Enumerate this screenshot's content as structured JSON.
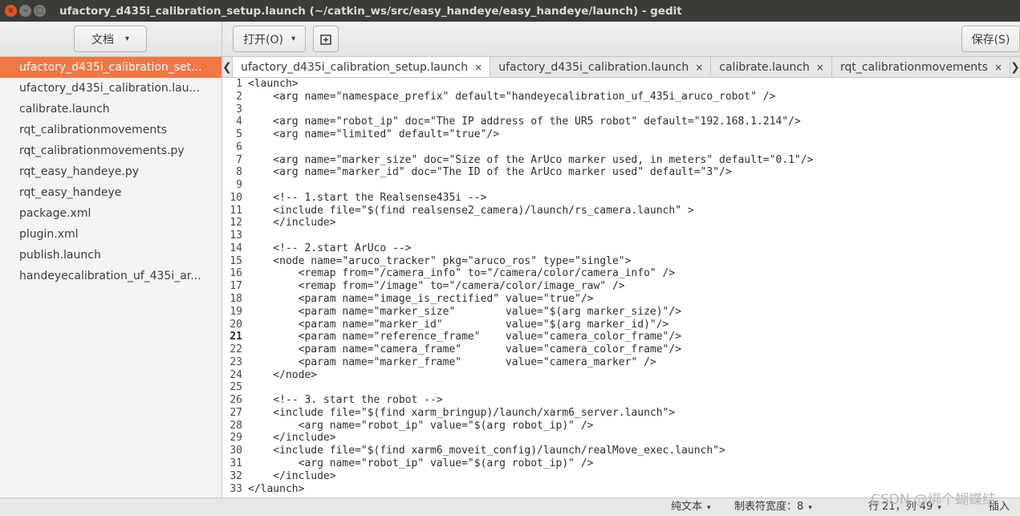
{
  "window": {
    "title": "ufactory_d435i_calibration_setup.launch (~/catkin_ws/src/easy_handeye/easy_handeye/launch) - gedit",
    "close_glyph": "×",
    "min_glyph": "–",
    "max_glyph": "□"
  },
  "toolbar": {
    "docs_label": "文档",
    "open_label": "打开(O)",
    "save_label": "保存(S)",
    "caret": "▾"
  },
  "sidebar": {
    "items": [
      {
        "label": "ufactory_d435i_calibration_set..."
      },
      {
        "label": "ufactory_d435i_calibration.lau..."
      },
      {
        "label": "calibrate.launch"
      },
      {
        "label": "rqt_calibrationmovements"
      },
      {
        "label": "rqt_calibrationmovements.py"
      },
      {
        "label": "rqt_easy_handeye.py"
      },
      {
        "label": "rqt_easy_handeye"
      },
      {
        "label": "package.xml"
      },
      {
        "label": "plugin.xml"
      },
      {
        "label": "publish.launch"
      },
      {
        "label": "handeyecalibration_uf_435i_ar..."
      }
    ]
  },
  "tabs": {
    "left_arrow": "❮",
    "right_arrow": "❯",
    "close_glyph": "×",
    "items": [
      {
        "label": "ufactory_d435i_calibration_setup.launch"
      },
      {
        "label": "ufactory_d435i_calibration.launch"
      },
      {
        "label": "calibrate.launch"
      },
      {
        "label": "rqt_calibrationmovements"
      }
    ]
  },
  "editor": {
    "current_line": 21,
    "lines": [
      "<launch>",
      "    <arg name=\"namespace_prefix\" default=\"handeyecalibration_uf_435i_aruco_robot\" />",
      "",
      "    <arg name=\"robot_ip\" doc=\"The IP address of the UR5 robot\" default=\"192.168.1.214\"/>",
      "    <arg name=\"limited\" default=\"true\"/>",
      "",
      "    <arg name=\"marker_size\" doc=\"Size of the ArUco marker used, in meters\" default=\"0.1\"/>",
      "    <arg name=\"marker_id\" doc=\"The ID of the ArUco marker used\" default=\"3\"/>",
      "",
      "    <!-- 1.start the Realsense435i -->",
      "    <include file=\"$(find realsense2_camera)/launch/rs_camera.launch\" >",
      "    </include>",
      "",
      "    <!-- 2.start ArUco -->",
      "    <node name=\"aruco_tracker\" pkg=\"aruco_ros\" type=\"single\">",
      "        <remap from=\"/camera_info\" to=\"/camera/color/camera_info\" />",
      "        <remap from=\"/image\" to=\"/camera/color/image_raw\" />",
      "        <param name=\"image_is_rectified\" value=\"true\"/>",
      "        <param name=\"marker_size\"        value=\"$(arg marker_size)\"/>",
      "        <param name=\"marker_id\"          value=\"$(arg marker_id)\"/>",
      "        <param name=\"reference_frame\"    value=\"camera_color_frame\"/>",
      "        <param name=\"camera_frame\"       value=\"camera_color_frame\"/>",
      "        <param name=\"marker_frame\"       value=\"camera_marker\" />",
      "    </node>",
      "",
      "    <!-- 3. start the robot -->",
      "    <include file=\"$(find xarm_bringup)/launch/xarm6_server.launch\">",
      "        <arg name=\"robot_ip\" value=\"$(arg robot_ip)\" />",
      "    </include>",
      "    <include file=\"$(find xarm6_moveit_config)/launch/realMove_exec.launch\">",
      "        <arg name=\"robot_ip\" value=\"$(arg robot_ip)\" />",
      "    </include>",
      "</launch>"
    ]
  },
  "statusbar": {
    "syntax_label": "纯文本",
    "tab_width_label": "制表符宽度：8",
    "position_label": "行 21，列 49",
    "insert_mode": "插入",
    "caret": "▾"
  },
  "watermark": "CSDN @绑个蝴蝶结"
}
